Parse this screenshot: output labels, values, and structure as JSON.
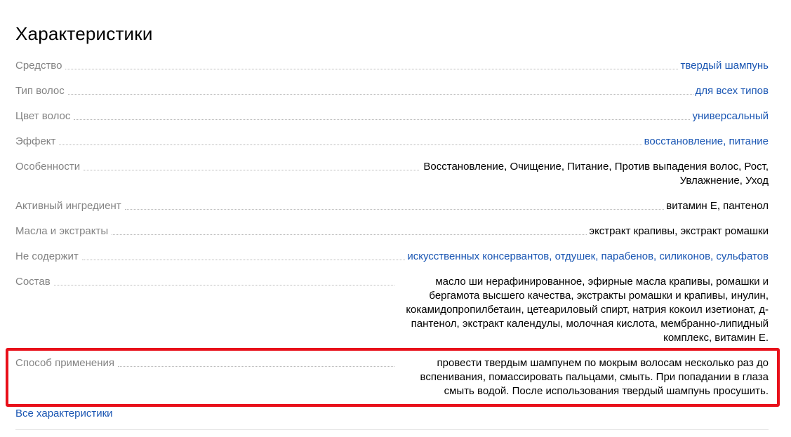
{
  "section": {
    "title": "Характеристики",
    "all_link": "Все характеристики"
  },
  "specs": [
    {
      "label": "Средство",
      "value": "твердый шампунь",
      "is_link": true
    },
    {
      "label": "Тип волос",
      "value": "для всех типов",
      "is_link": true
    },
    {
      "label": "Цвет волос",
      "value": "универсальный",
      "is_link": true
    },
    {
      "label": "Эффект",
      "value": "восстановление, питание",
      "is_link": true
    },
    {
      "label": "Особенности",
      "value": "Восстановление, Очищение, Питание, Против выпадения волос, Рост, Увлажнение, Уход",
      "is_link": false
    },
    {
      "label": "Активный ингредиент",
      "value": "витамин Е, пантенол",
      "is_link": false
    },
    {
      "label": "Масла и экстракты",
      "value": "экстракт крапивы, экстракт ромашки",
      "is_link": false
    },
    {
      "label": "Не содержит",
      "value": "искусственных консервантов, отдушек, парабенов, силиконов, сульфатов",
      "is_link": true
    },
    {
      "label": "Состав",
      "value": "масло ши нерафинированное, эфирные масла крапивы, ромашки и бергамота высшего качества, экстракты ромашки и крапивы, инулин, кокамидопропилбетаин, цетеариловый спирт, натрия кокоил изетионат, д-пантенол, экстракт календулы, молочная кислота, мембранно-липидный комплекс, витамин Е.",
      "is_link": false
    },
    {
      "label": "Способ применения",
      "value": "провести твердым шампунем по мокрым волосам несколько раз до вспенивания, помассировать пальцами, смыть. При попадании в глаза смыть водой. После использования твердый шампунь просушить.",
      "is_link": false
    }
  ],
  "colors": {
    "label": "#838383",
    "link": "#1a56b3",
    "highlight": "#e8101a"
  }
}
